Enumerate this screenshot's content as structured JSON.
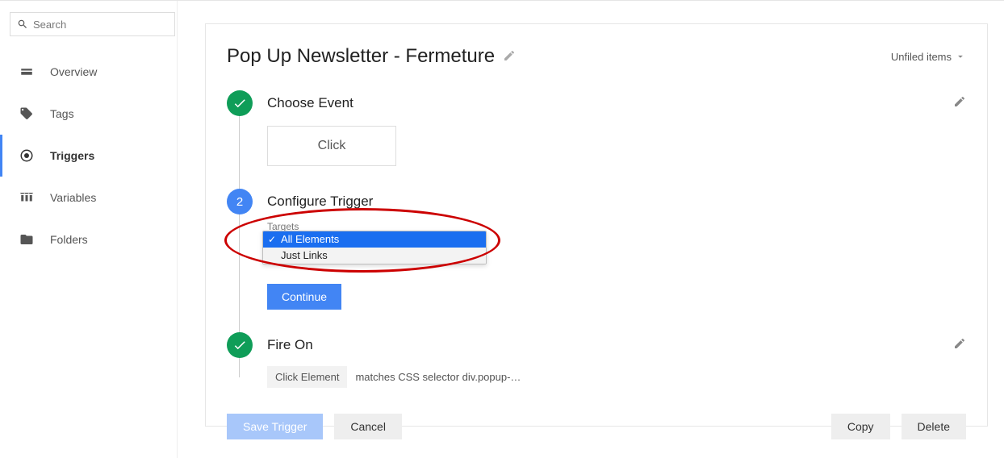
{
  "search": {
    "placeholder": "Search"
  },
  "sidebar": {
    "items": [
      {
        "label": "Overview"
      },
      {
        "label": "Tags"
      },
      {
        "label": "Triggers"
      },
      {
        "label": "Variables"
      },
      {
        "label": "Folders"
      }
    ]
  },
  "page": {
    "title": "Pop Up Newsletter - Fermeture",
    "folder": "Unfiled items"
  },
  "steps": {
    "choose_event": {
      "title": "Choose Event",
      "value": "Click"
    },
    "configure": {
      "number": "2",
      "title": "Configure Trigger",
      "targets_label": "Targets",
      "options": [
        {
          "label": "All Elements",
          "selected": true
        },
        {
          "label": "Just Links",
          "selected": false
        }
      ],
      "continue": "Continue"
    },
    "fire_on": {
      "title": "Fire On",
      "field": "Click Element",
      "condition": "matches CSS selector div.popup-…"
    }
  },
  "buttons": {
    "save": "Save Trigger",
    "cancel": "Cancel",
    "copy": "Copy",
    "delete": "Delete"
  }
}
